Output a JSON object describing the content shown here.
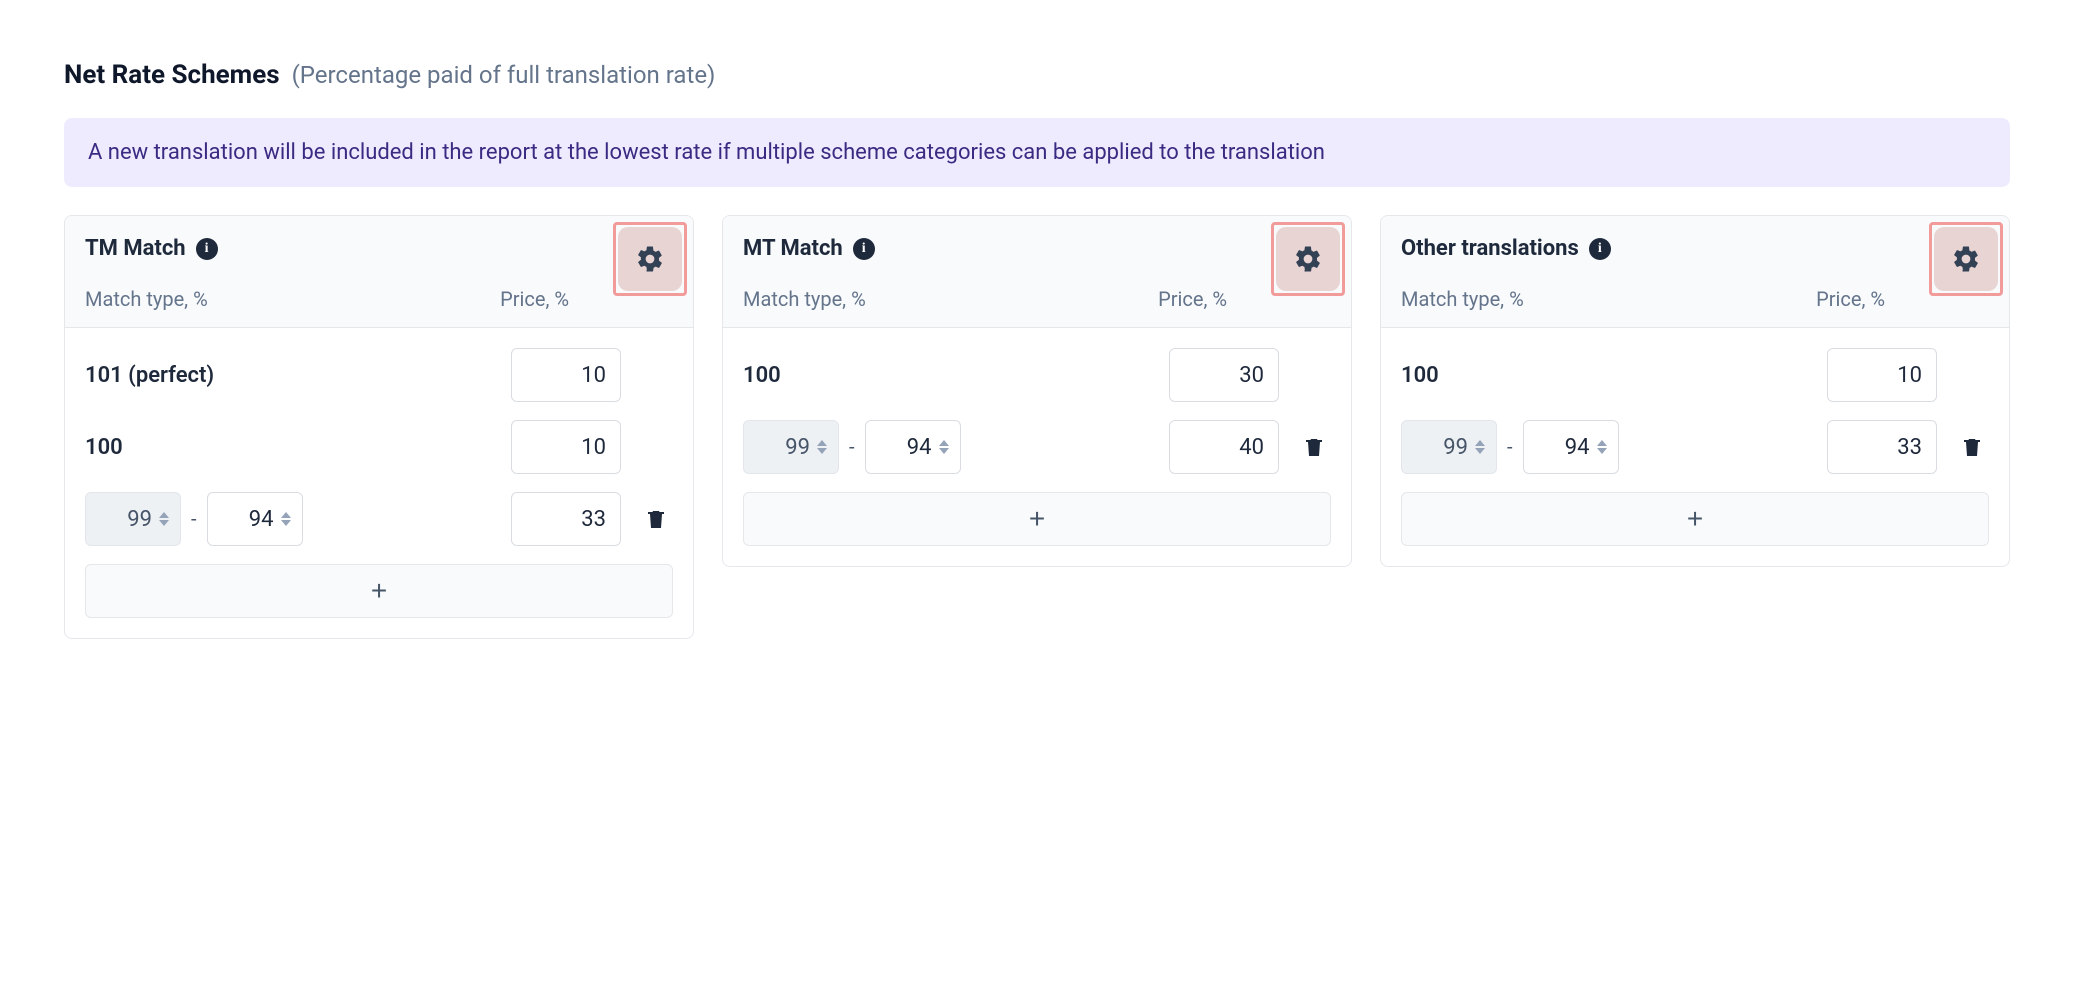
{
  "header": {
    "title": "Net Rate Schemes",
    "subtitle": "(Percentage paid of full translation rate)"
  },
  "banner": "A new translation will be included in the report at the lowest rate if multiple scheme categories can be applied to the translation",
  "labels": {
    "match_type": "Match type, %",
    "price": "Price, %",
    "add": "+",
    "dash": "-"
  },
  "cards": {
    "tm": {
      "title": "TM Match",
      "rows": {
        "perfect": {
          "label": "101 (perfect)",
          "price": "10"
        },
        "m100": {
          "label": "100",
          "price": "10"
        },
        "range": {
          "from": "99",
          "to": "94",
          "price": "33"
        }
      }
    },
    "mt": {
      "title": "MT Match",
      "rows": {
        "m100": {
          "label": "100",
          "price": "30"
        },
        "range": {
          "from": "99",
          "to": "94",
          "price": "40"
        }
      }
    },
    "other": {
      "title": "Other translations",
      "rows": {
        "m100": {
          "label": "100",
          "price": "10"
        },
        "range": {
          "from": "99",
          "to": "94",
          "price": "33"
        }
      }
    }
  }
}
